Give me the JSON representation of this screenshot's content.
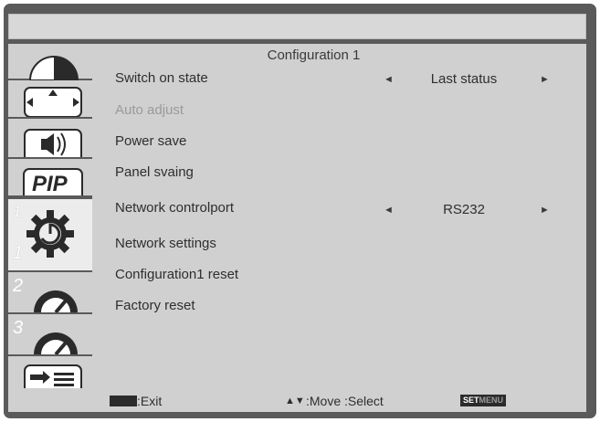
{
  "menu": {
    "title": "Configuration 1",
    "items": [
      {
        "label": "Switch on state",
        "value": "Last status",
        "enabled": true
      },
      {
        "label": "Auto adjust",
        "enabled": false
      },
      {
        "label": "Power save",
        "enabled": true
      },
      {
        "label": "Panel svaing",
        "enabled": true
      },
      {
        "label": "Network controlport",
        "value": "RS232",
        "enabled": true
      },
      {
        "label": "Network settings",
        "enabled": true
      },
      {
        "label": "Configuration1 reset",
        "enabled": true
      },
      {
        "label": "Factory reset",
        "enabled": true
      }
    ]
  },
  "arrows": {
    "left": "◄",
    "right": "►"
  },
  "sidebar": {
    "tabs": [
      {
        "icon": "picture-icon"
      },
      {
        "icon": "screen-icon"
      },
      {
        "icon": "audio-icon"
      },
      {
        "icon": "pip-icon",
        "label": "PIP"
      },
      {
        "icon": "configuration-icon",
        "num_top": "1",
        "num_bottom": "1",
        "active": true
      },
      {
        "icon": "configuration-icon",
        "num": "2"
      },
      {
        "icon": "configuration-icon",
        "num": "3"
      },
      {
        "icon": "source-icon"
      }
    ]
  },
  "footer": {
    "exit_label": ":Exit",
    "move_label": ":Move :Select",
    "move_arrows": "▲▼",
    "set_label": "SET",
    "menu_label": "MENU"
  },
  "colors": {
    "frame": "#5a5a5a",
    "panel": "#d0d0d0",
    "active_tab": "#ececec",
    "text": "#2e2e2e",
    "disabled": "#9a9a9a"
  }
}
